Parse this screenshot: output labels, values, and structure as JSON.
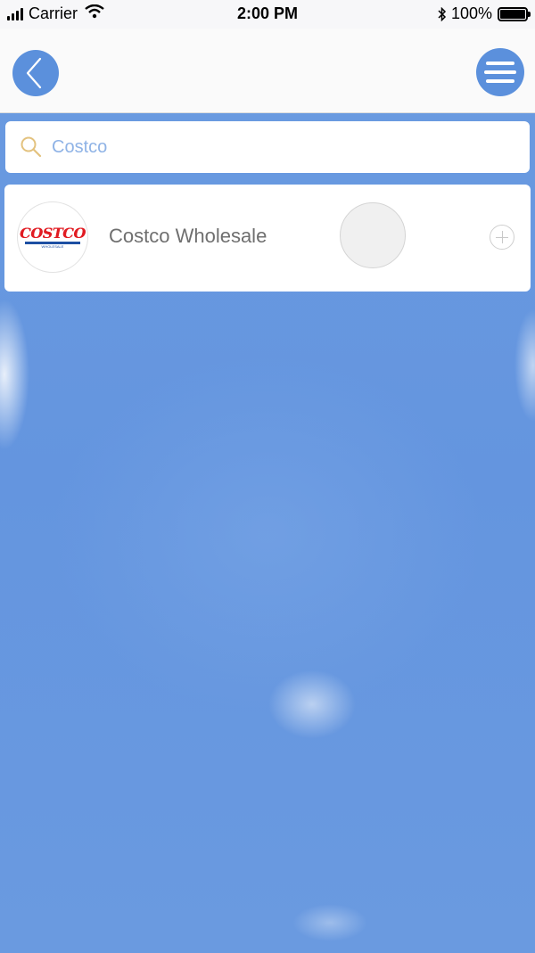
{
  "status_bar": {
    "carrier": "Carrier",
    "time": "2:00 PM",
    "battery": "100%",
    "icons": [
      "signal-icon",
      "wifi-icon",
      "bluetooth-icon",
      "battery-icon"
    ]
  },
  "nav": {
    "back_icon": "chevron-left-icon",
    "menu_icon": "hamburger-menu-icon",
    "accent_color": "#5b90dc"
  },
  "search": {
    "value": "Costco",
    "icon": "search-icon"
  },
  "results": [
    {
      "logo_text": "COSTCO",
      "logo_subtext": "WHOLESALE",
      "name": "Costco Wholesale",
      "action_icon": "plus-circle-icon"
    }
  ],
  "colors": {
    "background_sky": "#6a9ae0",
    "logo_red": "#e11b22",
    "logo_blue": "#1d4fa3"
  }
}
